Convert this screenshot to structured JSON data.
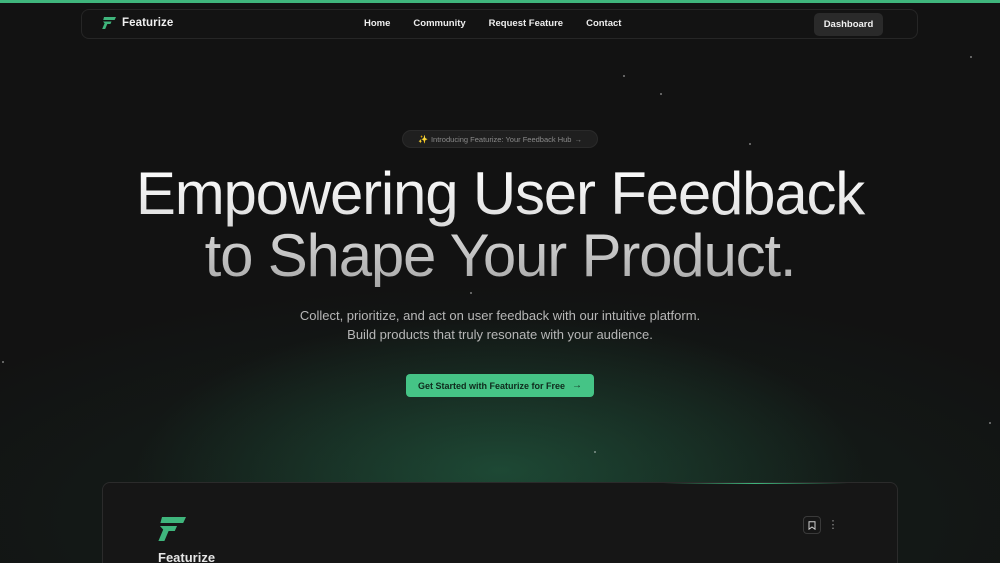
{
  "brand": {
    "name": "Featurize",
    "logo_icon": "featurize-logo-icon",
    "accent_color": "#3fb57c"
  },
  "nav": {
    "links": [
      "Home",
      "Community",
      "Request Feature",
      "Contact"
    ],
    "dashboard_label": "Dashboard"
  },
  "announcement": {
    "icon": "sparkle-icon",
    "text": "Introducing Featurize: Your Feedback Hub",
    "arrow": "→"
  },
  "hero": {
    "title_line1": "Empowering User Feedback",
    "title_line2": "to Shape Your Product.",
    "subtitle_line1": "Collect, prioritize, and act on user feedback with our intuitive platform.",
    "subtitle_line2": "Build products that truly resonate with your audience.",
    "cta_label": "Get Started with Featurize for Free",
    "cta_arrow": "→",
    "cta_color": "#45c486"
  },
  "preview": {
    "app_name": "Featurize",
    "bookmark_icon": "bookmark-icon",
    "more_icon": "more-vertical-icon"
  }
}
